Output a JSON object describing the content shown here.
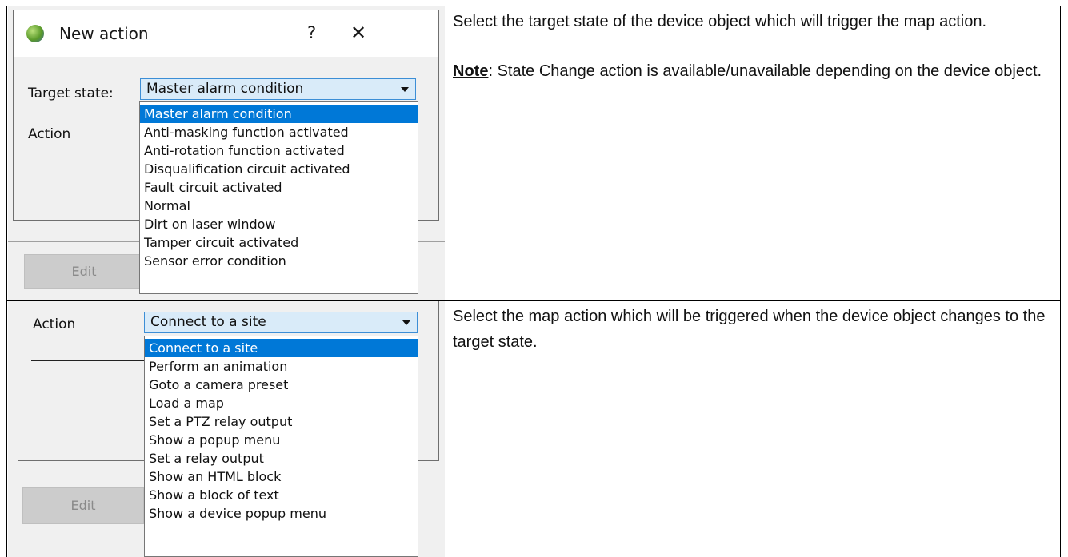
{
  "top": {
    "dialog_title": "New action",
    "help_glyph": "?",
    "close_glyph": "✕",
    "target_label": "Target state:",
    "target_value": "Master alarm condition",
    "action_label": "Action",
    "edit_label": "Edit",
    "options": [
      "Master alarm condition",
      "Anti-masking function activated",
      "Anti-rotation function activated",
      "Disqualification circuit activated",
      "Fault circuit activated",
      "Normal",
      "Dirt on laser window",
      "Tamper circuit activated",
      "Sensor error condition"
    ],
    "selected_index": 0,
    "description": "Select the target state of the device object which will trigger the map action.",
    "note_label": "Note",
    "note_text": ": State Change action is available/unavailable depending on the device object."
  },
  "bottom": {
    "action_label": "Action",
    "action_value": "Connect to a site",
    "edit_label": "Edit",
    "options": [
      "Connect to a site",
      "Perform an animation",
      "Goto a camera preset",
      "Load a map",
      "Set a PTZ relay output",
      "Show a popup menu",
      "Set a relay output",
      "Show an HTML block",
      "Show a block of text",
      "Show a device popup menu"
    ],
    "selected_index": 0,
    "description": "Select the map action which will be triggered when the device object changes to the target state."
  },
  "icons": {
    "app": "app-globe-icon",
    "dropdown": "chevron-down-icon",
    "help": "help-icon",
    "close": "close-icon"
  },
  "colors": {
    "selection": "#0078d7",
    "combo_fill": "#d9ebf9",
    "combo_border": "#3c8ed6",
    "dialog_bg": "#f0f0f0"
  }
}
